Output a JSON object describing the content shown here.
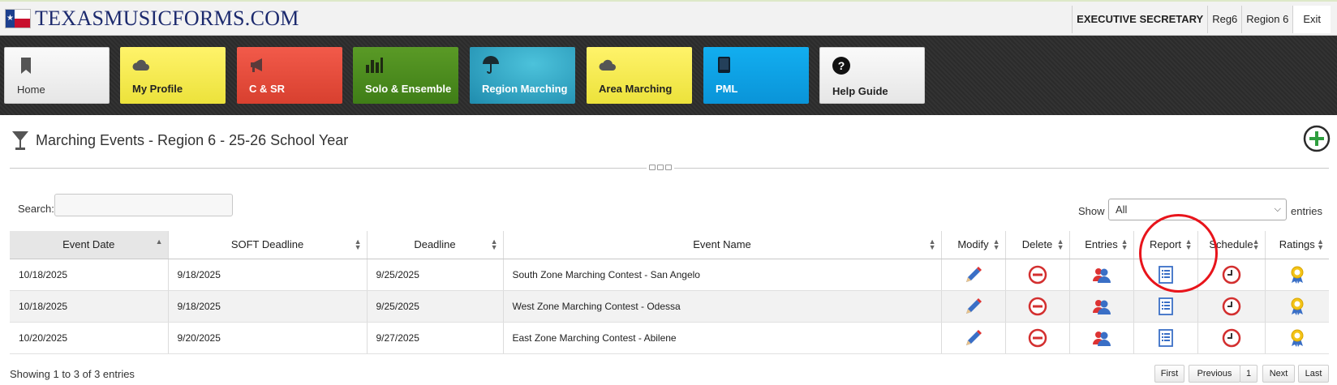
{
  "header": {
    "brand": "TEXASMUSICFORMS.COM",
    "flag_star": "★",
    "role": "EXECUTIVE SECRETARY",
    "region_code": "Reg6",
    "region_name": "Region 6",
    "exit": "Exit"
  },
  "nav": [
    {
      "label": "Home",
      "icon": "bookmark-icon",
      "color": "#eeeeee"
    },
    {
      "label": "My Profile",
      "icon": "cloud-icon",
      "color": "#f5ea4a"
    },
    {
      "label": "C & SR",
      "icon": "megaphone-icon",
      "color": "#e24c3b"
    },
    {
      "label": "Solo & Ensemble",
      "icon": "bar-chart-icon",
      "color": "#4d8c1f"
    },
    {
      "label": "Region Marching",
      "icon": "umbrella-icon",
      "color": "#2aa3c5"
    },
    {
      "label": "Area Marching",
      "icon": "cloud-icon",
      "color": "#f5ea4a"
    },
    {
      "label": "PML",
      "icon": "book-icon",
      "color": "#0ea2e6"
    },
    {
      "label": "Help Guide",
      "icon": "question-icon",
      "color": "#eeeeee"
    }
  ],
  "panel": {
    "title": "Marching Events - Region 6 - 25-26 School Year",
    "search_label": "Search:",
    "search_value": "",
    "show_label": "Show",
    "show_value": "All",
    "entries_label": "entries"
  },
  "table": {
    "columns": [
      "Event Date",
      "SOFT Deadline",
      "Deadline",
      "Event Name",
      "Modify",
      "Delete",
      "Entries",
      "Report",
      "Schedule",
      "Ratings"
    ],
    "rows": [
      {
        "event_date": "10/18/2025",
        "soft_deadline": "9/18/2025",
        "deadline": "9/25/2025",
        "event_name": "South Zone Marching Contest - San Angelo"
      },
      {
        "event_date": "10/18/2025",
        "soft_deadline": "9/18/2025",
        "deadline": "9/25/2025",
        "event_name": "West Zone Marching Contest - Odessa"
      },
      {
        "event_date": "10/20/2025",
        "soft_deadline": "9/20/2025",
        "deadline": "9/27/2025",
        "event_name": "East Zone Marching Contest - Abilene"
      }
    ]
  },
  "footer": {
    "info": "Showing 1 to 3 of 3 entries",
    "first": "First",
    "previous": "Previous",
    "page": "1",
    "next": "Next",
    "last": "Last"
  },
  "colors": {
    "brand_text": "#1c2a6e",
    "highlight_circle": "#e8141b",
    "delete_icon": "#d32f2f",
    "add_icon": "#2e9e3e"
  }
}
